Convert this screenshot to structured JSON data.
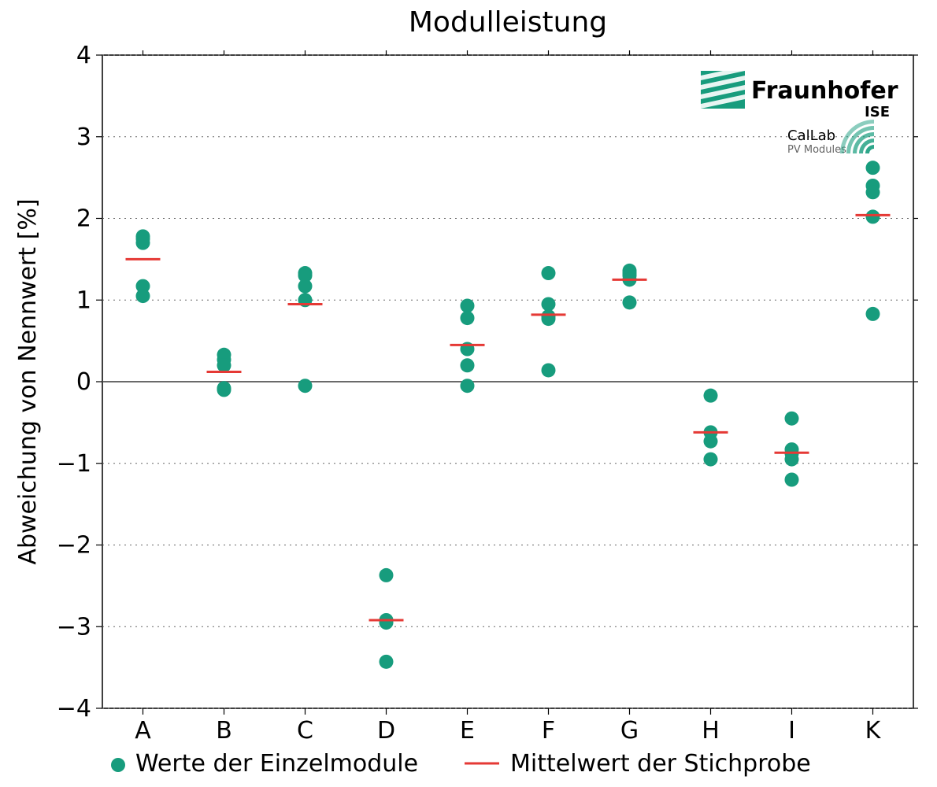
{
  "chart_data": {
    "type": "scatter",
    "title": "Modulleistung",
    "xlabel": "",
    "ylabel": "Abweichung von Nennwert [%]",
    "ylim": [
      -4,
      4
    ],
    "yticks": [
      -4,
      -3,
      -2,
      -1,
      0,
      1,
      2,
      3,
      4
    ],
    "categories": [
      "A",
      "B",
      "C",
      "D",
      "E",
      "F",
      "G",
      "H",
      "I",
      "K"
    ],
    "series": [
      {
        "name": "Werte der Einzelmodule",
        "type": "points",
        "color": "#179c7d",
        "values": [
          [
            1.78,
            1.75,
            1.7,
            1.17,
            1.05
          ],
          [
            0.33,
            0.27,
            0.2,
            -0.1,
            -0.08
          ],
          [
            1.33,
            1.3,
            1.17,
            1.0,
            -0.05
          ],
          [
            -2.37,
            -2.92,
            -2.95,
            -3.43
          ],
          [
            0.93,
            0.78,
            0.4,
            0.2,
            -0.05
          ],
          [
            1.33,
            0.95,
            0.8,
            0.77,
            0.14
          ],
          [
            1.36,
            1.33,
            1.3,
            1.25,
            0.97
          ],
          [
            -0.17,
            -0.62,
            -0.73,
            -0.95
          ],
          [
            -0.45,
            -0.83,
            -0.88,
            -0.95,
            -1.2
          ],
          [
            2.62,
            2.4,
            2.32,
            2.02,
            0.83
          ]
        ]
      },
      {
        "name": "Mittelwert der Stichprobe",
        "type": "dash",
        "color": "#e53935",
        "values": [
          1.5,
          0.12,
          0.95,
          -2.92,
          0.45,
          0.82,
          1.25,
          -0.62,
          -0.87,
          2.04
        ]
      }
    ],
    "legend_entries": [
      "Werte der Einzelmodule",
      "Mittelwert der Stichprobe"
    ],
    "logos": [
      {
        "name": "Fraunhofer",
        "sub": "ISE"
      },
      {
        "name": "CalLab",
        "sub": "PV Modules"
      }
    ]
  }
}
